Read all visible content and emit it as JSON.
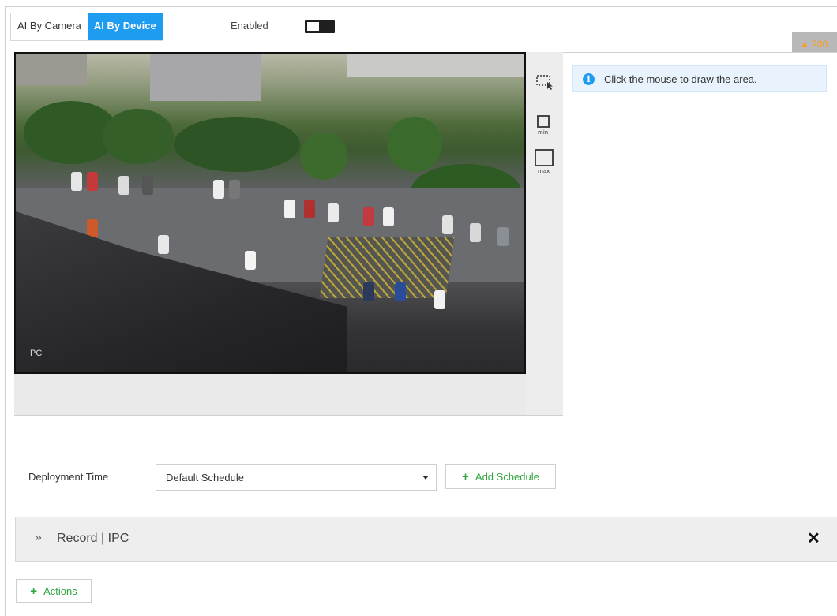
{
  "tabs": [
    {
      "label": "AI By Camera",
      "active": false
    },
    {
      "label": "AI By Device",
      "active": true
    }
  ],
  "enabled": {
    "label": "Enabled",
    "state": false
  },
  "warning_badge": {
    "text": "200",
    "icon": "warning-icon"
  },
  "video": {
    "channel_label": "PC"
  },
  "tools": {
    "draw": {
      "icon": "draw-area-icon"
    },
    "min": {
      "icon": "min-target-icon",
      "label": "min"
    },
    "max": {
      "icon": "max-target-icon",
      "label": "max"
    }
  },
  "info": {
    "icon": "info-icon",
    "text": "Click the mouse to draw the area."
  },
  "deployment": {
    "label": "Deployment Time",
    "selected": "Default Schedule",
    "add_label": "Add Schedule"
  },
  "record": {
    "title": "Record | IPC"
  },
  "actions": {
    "label": "Actions"
  },
  "colors": {
    "accent": "#1e9cf0",
    "add_green": "#2fa63f",
    "warning": "#ff9a1a"
  }
}
